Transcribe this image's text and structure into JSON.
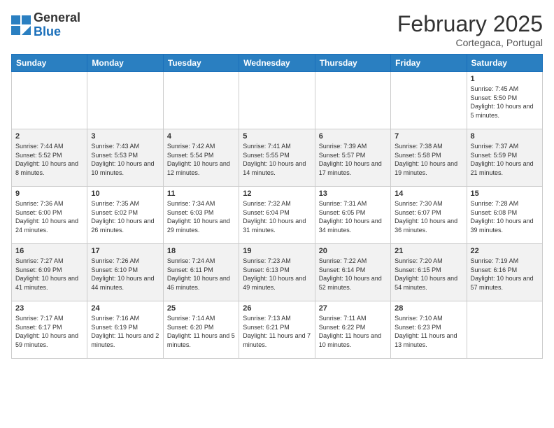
{
  "header": {
    "logo_general": "General",
    "logo_blue": "Blue",
    "month_title": "February 2025",
    "subtitle": "Cortegaca, Portugal"
  },
  "weekdays": [
    "Sunday",
    "Monday",
    "Tuesday",
    "Wednesday",
    "Thursday",
    "Friday",
    "Saturday"
  ],
  "weeks": [
    [
      null,
      null,
      null,
      null,
      null,
      null,
      {
        "day": "1",
        "sunrise": "7:45 AM",
        "sunset": "5:50 PM",
        "daylight": "10 hours and 5 minutes."
      }
    ],
    [
      {
        "day": "2",
        "sunrise": "7:44 AM",
        "sunset": "5:52 PM",
        "daylight": "10 hours and 8 minutes."
      },
      {
        "day": "3",
        "sunrise": "7:43 AM",
        "sunset": "5:53 PM",
        "daylight": "10 hours and 10 minutes."
      },
      {
        "day": "4",
        "sunrise": "7:42 AM",
        "sunset": "5:54 PM",
        "daylight": "10 hours and 12 minutes."
      },
      {
        "day": "5",
        "sunrise": "7:41 AM",
        "sunset": "5:55 PM",
        "daylight": "10 hours and 14 minutes."
      },
      {
        "day": "6",
        "sunrise": "7:39 AM",
        "sunset": "5:57 PM",
        "daylight": "10 hours and 17 minutes."
      },
      {
        "day": "7",
        "sunrise": "7:38 AM",
        "sunset": "5:58 PM",
        "daylight": "10 hours and 19 minutes."
      },
      {
        "day": "8",
        "sunrise": "7:37 AM",
        "sunset": "5:59 PM",
        "daylight": "10 hours and 21 minutes."
      }
    ],
    [
      {
        "day": "9",
        "sunrise": "7:36 AM",
        "sunset": "6:00 PM",
        "daylight": "10 hours and 24 minutes."
      },
      {
        "day": "10",
        "sunrise": "7:35 AM",
        "sunset": "6:02 PM",
        "daylight": "10 hours and 26 minutes."
      },
      {
        "day": "11",
        "sunrise": "7:34 AM",
        "sunset": "6:03 PM",
        "daylight": "10 hours and 29 minutes."
      },
      {
        "day": "12",
        "sunrise": "7:32 AM",
        "sunset": "6:04 PM",
        "daylight": "10 hours and 31 minutes."
      },
      {
        "day": "13",
        "sunrise": "7:31 AM",
        "sunset": "6:05 PM",
        "daylight": "10 hours and 34 minutes."
      },
      {
        "day": "14",
        "sunrise": "7:30 AM",
        "sunset": "6:07 PM",
        "daylight": "10 hours and 36 minutes."
      },
      {
        "day": "15",
        "sunrise": "7:28 AM",
        "sunset": "6:08 PM",
        "daylight": "10 hours and 39 minutes."
      }
    ],
    [
      {
        "day": "16",
        "sunrise": "7:27 AM",
        "sunset": "6:09 PM",
        "daylight": "10 hours and 41 minutes."
      },
      {
        "day": "17",
        "sunrise": "7:26 AM",
        "sunset": "6:10 PM",
        "daylight": "10 hours and 44 minutes."
      },
      {
        "day": "18",
        "sunrise": "7:24 AM",
        "sunset": "6:11 PM",
        "daylight": "10 hours and 46 minutes."
      },
      {
        "day": "19",
        "sunrise": "7:23 AM",
        "sunset": "6:13 PM",
        "daylight": "10 hours and 49 minutes."
      },
      {
        "day": "20",
        "sunrise": "7:22 AM",
        "sunset": "6:14 PM",
        "daylight": "10 hours and 52 minutes."
      },
      {
        "day": "21",
        "sunrise": "7:20 AM",
        "sunset": "6:15 PM",
        "daylight": "10 hours and 54 minutes."
      },
      {
        "day": "22",
        "sunrise": "7:19 AM",
        "sunset": "6:16 PM",
        "daylight": "10 hours and 57 minutes."
      }
    ],
    [
      {
        "day": "23",
        "sunrise": "7:17 AM",
        "sunset": "6:17 PM",
        "daylight": "10 hours and 59 minutes."
      },
      {
        "day": "24",
        "sunrise": "7:16 AM",
        "sunset": "6:19 PM",
        "daylight": "11 hours and 2 minutes."
      },
      {
        "day": "25",
        "sunrise": "7:14 AM",
        "sunset": "6:20 PM",
        "daylight": "11 hours and 5 minutes."
      },
      {
        "day": "26",
        "sunrise": "7:13 AM",
        "sunset": "6:21 PM",
        "daylight": "11 hours and 7 minutes."
      },
      {
        "day": "27",
        "sunrise": "7:11 AM",
        "sunset": "6:22 PM",
        "daylight": "11 hours and 10 minutes."
      },
      {
        "day": "28",
        "sunrise": "7:10 AM",
        "sunset": "6:23 PM",
        "daylight": "11 hours and 13 minutes."
      },
      null
    ]
  ]
}
